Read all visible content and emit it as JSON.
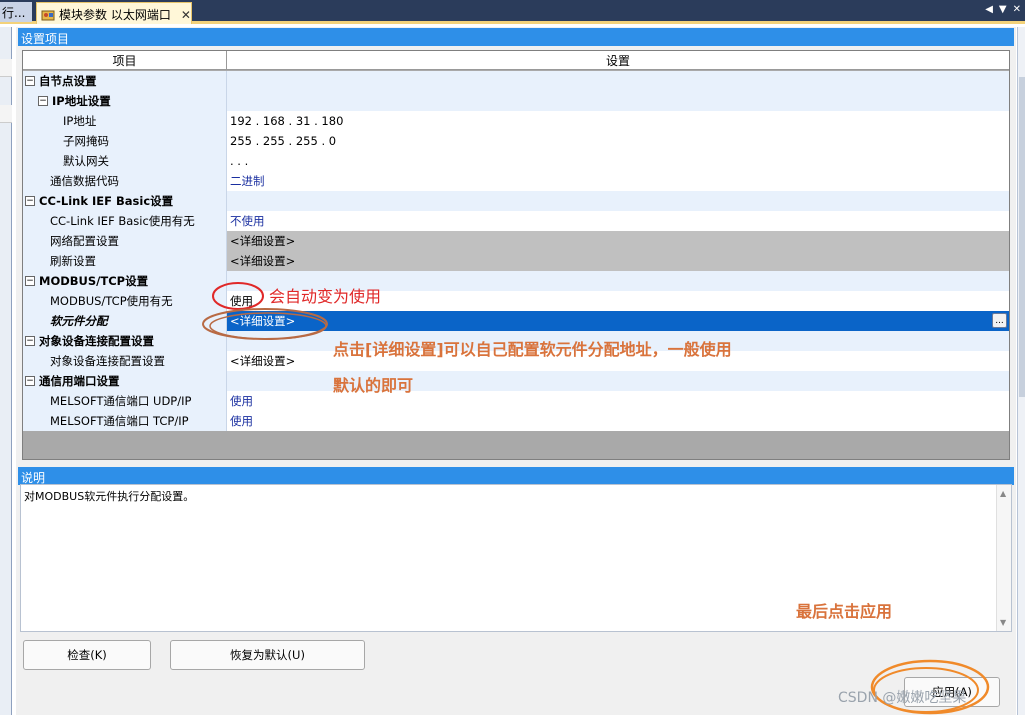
{
  "tabs": {
    "prev_label": "行...",
    "active_label": "模块参数 以太网端口",
    "close_glyph": "✕"
  },
  "window_controls": [
    "◀",
    "▼",
    "✕"
  ],
  "settings_section": {
    "header": "设置项目",
    "col_item": "项目",
    "col_setting": "设置",
    "rows": [
      {
        "label": "自节点设置",
        "value": "",
        "level": 0,
        "kind": "category",
        "toggle": "−"
      },
      {
        "label": "IP地址设置",
        "value": "",
        "level": 1,
        "kind": "category",
        "toggle": "−"
      },
      {
        "label": "IP地址",
        "value": "192 . 168 .  31 . 180",
        "level": 2,
        "kind": "plain"
      },
      {
        "label": "子网掩码",
        "value": "255 . 255 . 255 .   0",
        "level": 2,
        "kind": "plain"
      },
      {
        "label": "默认网关",
        "value": "     .     .     .",
        "level": 2,
        "kind": "plain"
      },
      {
        "label": "通信数据代码",
        "value": "二进制",
        "level": 1,
        "kind": "blue"
      },
      {
        "label": "CC-Link IEF Basic设置",
        "value": "",
        "level": 0,
        "kind": "category",
        "toggle": "−"
      },
      {
        "label": "CC-Link IEF Basic使用有无",
        "value": "不使用",
        "level": 1,
        "kind": "blue"
      },
      {
        "label": "网络配置设置",
        "value": "<详细设置>",
        "level": 1,
        "kind": "gray"
      },
      {
        "label": "刷新设置",
        "value": "<详细设置>",
        "level": 1,
        "kind": "gray"
      },
      {
        "label": "MODBUS/TCP设置",
        "value": "",
        "level": 0,
        "kind": "category",
        "toggle": "−"
      },
      {
        "label": "MODBUS/TCP使用有无",
        "value": "使用",
        "level": 1,
        "kind": "plain"
      },
      {
        "label": "软元件分配",
        "value": "<详细设置>",
        "level": 1,
        "kind": "selected"
      },
      {
        "label": "对象设备连接配置设置",
        "value": "",
        "level": 0,
        "kind": "category",
        "toggle": "−"
      },
      {
        "label": "对象设备连接配置设置",
        "value": "<详细设置>",
        "level": 1,
        "kind": "plain"
      },
      {
        "label": "通信用端口设置",
        "value": "",
        "level": 0,
        "kind": "category",
        "toggle": "−"
      },
      {
        "label": "MELSOFT通信端口 UDP/IP",
        "value": "使用",
        "level": 1,
        "kind": "blue"
      },
      {
        "label": "MELSOFT通信端口 TCP/IP",
        "value": "使用",
        "level": 1,
        "kind": "blue"
      }
    ],
    "ellipsis_button": "..."
  },
  "description_section": {
    "header": "说明",
    "text": "对MODBUS软元件执行分配设置。"
  },
  "buttons": {
    "check": "检查(K)",
    "restore_default": "恢复为默认(U)",
    "apply": "应用(A)"
  },
  "annotations": {
    "auto_use": "会自动变为使用",
    "detail_hint_line1": "点击[详细设置]可以自己配置软元件分配地址，一般使用",
    "detail_hint_line2": "默认的即可",
    "apply_hint": "最后点击应用"
  },
  "watermark": "CSDN @嫩嫩吃坚果",
  "colors": {
    "accent_blue": "#2e8fe8",
    "selected_row": "#0a64c8",
    "annotation_red": "#e02828",
    "annotation_orange": "#d9733c"
  }
}
